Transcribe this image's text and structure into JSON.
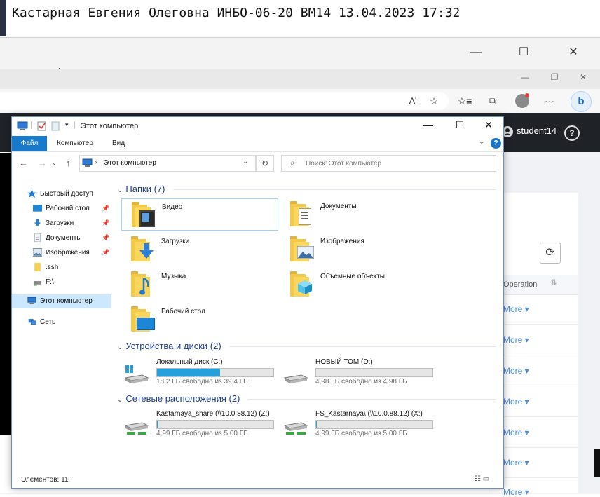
{
  "caption": {
    "text": "Кастарная Евгения Олеговна ИНБО-06-20 ВМ14 13.04.2023 17:32"
  },
  "outer_window": {
    "minimize": "—",
    "maximize": "☐",
    "close": "✕"
  },
  "edge": {
    "window_controls": {
      "minimize": "—",
      "restore": "❐",
      "close": "✕"
    },
    "toolbar_icons": {
      "read_aloud": "A’",
      "favorites_add": "☆",
      "favorites": "☆≡",
      "collections": "⧉",
      "more": "···",
      "bing": "b"
    }
  },
  "page": {
    "user": "student14",
    "help": "?",
    "refresh": "⟳",
    "operation_header": "Operation",
    "sort_icon": "⇅",
    "more_links": [
      "More ▾",
      "More ▾",
      "More ▾",
      "More ▾",
      "More ▾",
      "More ▾",
      "More ▾"
    ]
  },
  "explorer": {
    "title": "Этот компьютер",
    "window_controls": {
      "minimize": "—",
      "maximize": "☐",
      "close": "✕"
    },
    "ribbon": {
      "file": "Файл",
      "computer": "Компьютер",
      "view": "Вид",
      "help": "?"
    },
    "nav": {
      "back": "←",
      "forward": "→",
      "up": "↑",
      "address": "Этот компьютер",
      "refresh": "↻",
      "search_placeholder": "Поиск: Этот компьютер"
    },
    "sidebar": [
      {
        "label": "Быстрый доступ",
        "icon": "star-icon",
        "pinned": false,
        "selected": false
      },
      {
        "label": "Рабочий стол",
        "icon": "desktop-icon",
        "pinned": true,
        "selected": false
      },
      {
        "label": "Загрузки",
        "icon": "download-icon",
        "pinned": true,
        "selected": false
      },
      {
        "label": "Документы",
        "icon": "documents-icon",
        "pinned": true,
        "selected": false
      },
      {
        "label": "Изображения",
        "icon": "pictures-icon",
        "pinned": true,
        "selected": false
      },
      {
        "label": ".ssh",
        "icon": "folder-icon",
        "pinned": false,
        "selected": false
      },
      {
        "label": "F:\\",
        "icon": "network-drive-icon",
        "pinned": false,
        "selected": false
      },
      {
        "label": "Этот компьютер",
        "icon": "this-pc-icon",
        "pinned": false,
        "selected": true
      },
      {
        "label": "Сеть",
        "icon": "network-icon",
        "pinned": false,
        "selected": false
      }
    ],
    "groups": {
      "folders": "Папки (7)",
      "devices": "Устройства и диски (2)",
      "network": "Сетевые расположения (2)"
    },
    "folders": [
      {
        "label": "Видео",
        "icon": "video-folder-icon",
        "selected": true
      },
      {
        "label": "Документы",
        "icon": "documents-folder-icon",
        "selected": false
      },
      {
        "label": "Загрузки",
        "icon": "downloads-folder-icon",
        "selected": false
      },
      {
        "label": "Изображения",
        "icon": "pictures-folder-icon",
        "selected": false
      },
      {
        "label": "Музыка",
        "icon": "music-folder-icon",
        "selected": false
      },
      {
        "label": "Объемные объекты",
        "icon": "3d-objects-folder-icon",
        "selected": false
      },
      {
        "label": "Рабочий стол",
        "icon": "desktop-folder-icon",
        "selected": false
      }
    ],
    "drives": [
      {
        "name": "Локальный диск (C:)",
        "free": "18,2 ГБ свободно из 39,4 ГБ",
        "used_fraction": 0.54
      },
      {
        "name": "НОВЫЙ ТОМ (D:)",
        "free": "4,98 ГБ свободно из 4,98 ГБ",
        "used_fraction": 0.0
      }
    ],
    "network_drives": [
      {
        "name": "Kastarnaya_share (\\\\10.0.88.12) (Z:)",
        "free": "4,99 ГБ свободно из 5,00 ГБ",
        "used_fraction": 0.002
      },
      {
        "name": "FS_Kastarnaya\\ (\\\\10.0.88.12) (X:)",
        "free": "4,99 ГБ свободно из 5,00 ГБ",
        "used_fraction": 0.002
      }
    ],
    "status": "Элементов: 11",
    "view_icons": "☷ ▭"
  }
}
